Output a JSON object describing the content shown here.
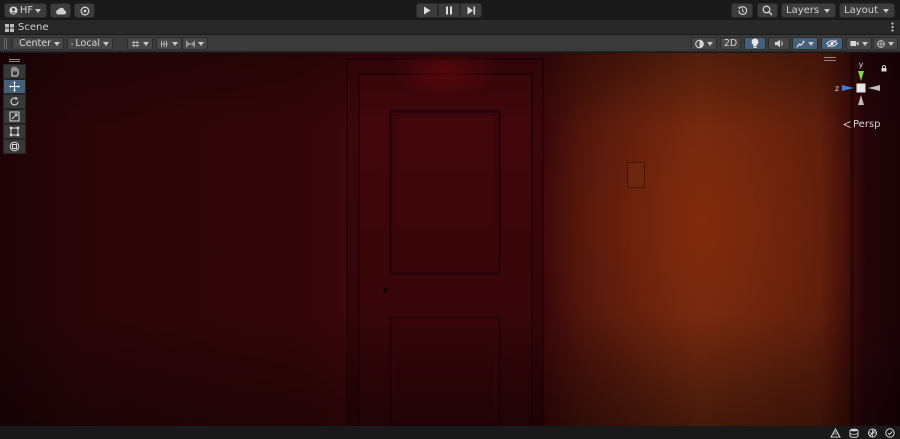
{
  "toolbar": {
    "account_label": "HF",
    "layers_label": "Layers",
    "layout_label": "Layout"
  },
  "scene_tab": {
    "title": "Scene"
  },
  "scene_toolbar": {
    "pivot_label": "Center",
    "space_label": "Local",
    "mode_2d_label": "2D"
  },
  "viewport": {
    "projection_label": "Persp",
    "gizmo_axes": {
      "y": "y",
      "z": "z"
    }
  },
  "icons": {
    "account": "account-icon",
    "cloud": "cloud-icon",
    "services": "services-icon",
    "play": "play-icon",
    "pause": "pause-icon",
    "step": "step-icon",
    "history": "history-icon",
    "search": "search-icon",
    "hand": "hand-tool-icon",
    "move": "move-tool-icon",
    "rotate": "rotate-tool-icon",
    "scale": "scale-tool-icon",
    "rect": "rect-tool-icon",
    "transform": "transform-tool-icon",
    "lock": "lock-icon"
  },
  "colors": {
    "accent": "#46607c",
    "toolbar_bg": "#191919",
    "scene_bar_bg": "#3a3a3a"
  }
}
